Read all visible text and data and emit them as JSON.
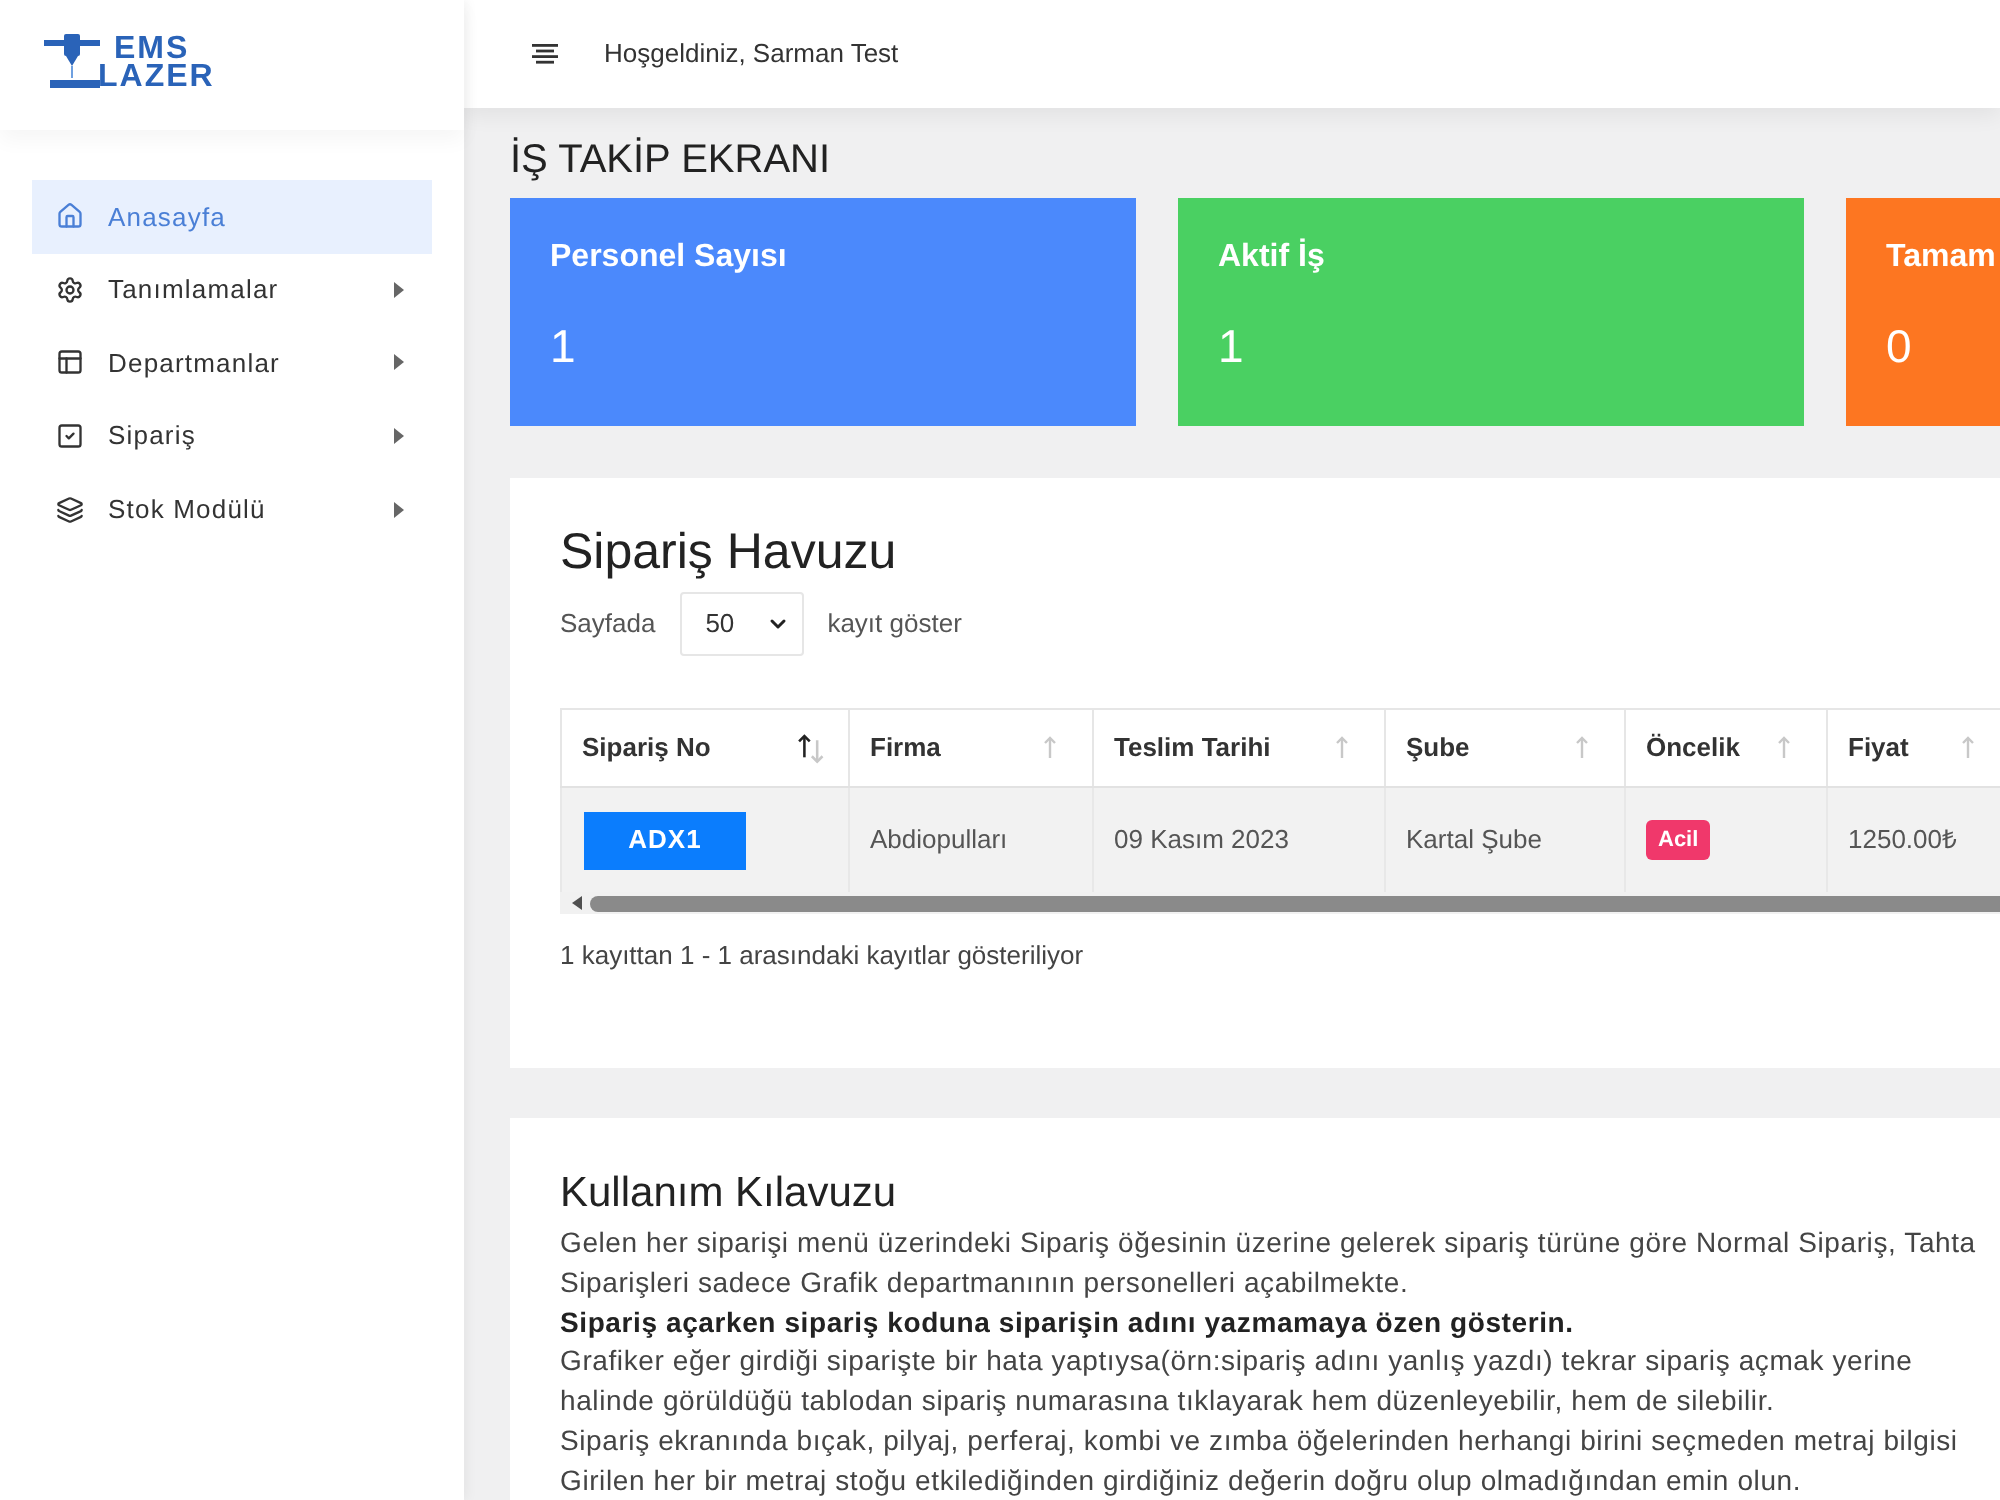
{
  "sidebar": {
    "logo": {
      "top": "EMS",
      "bottom": "LAZER"
    },
    "items": [
      {
        "label": "Anasayfa",
        "selected": true,
        "submenu": false
      },
      {
        "label": "Tanımlamalar",
        "selected": false,
        "submenu": true
      },
      {
        "label": "Departmanlar",
        "selected": false,
        "submenu": true
      },
      {
        "label": "Sipariş",
        "selected": false,
        "submenu": true
      },
      {
        "label": "Stok Modülü",
        "selected": false,
        "submenu": true
      }
    ]
  },
  "topbar": {
    "greeting": "Hoşgeldiniz, Sarman Test"
  },
  "page_title": "İŞ TAKİP EKRANI",
  "stat_cards": [
    {
      "label": "Personel Sayısı",
      "value": "1",
      "color": "#4b89fc"
    },
    {
      "label": "Aktif İş",
      "value": "1",
      "color": "#4ad062"
    },
    {
      "label": "Tamam",
      "value": "0",
      "color": "#fd7621"
    }
  ],
  "order_pool": {
    "title": "Sipariş Havuzu",
    "length_menu": {
      "before": "Sayfada",
      "value": "50",
      "after": "kayıt göster"
    },
    "table": {
      "columns": [
        {
          "label": "Sipariş No",
          "sorted": true
        },
        {
          "label": "Firma",
          "sorted": false
        },
        {
          "label": "Teslim Tarihi",
          "sorted": false
        },
        {
          "label": "Şube",
          "sorted": false
        },
        {
          "label": "Öncelik",
          "sorted": false
        },
        {
          "label": "Fiyat",
          "sorted": false
        }
      ],
      "rows": [
        {
          "cells": [
            {
              "kind": "button",
              "text": "ADX1"
            },
            {
              "kind": "text",
              "text": "Abdiopulları"
            },
            {
              "kind": "text",
              "text": "09 Kasım 2023"
            },
            {
              "kind": "text",
              "text": "Kartal Şube"
            },
            {
              "kind": "badge",
              "text": "Acil"
            },
            {
              "kind": "text",
              "text": "1250.00₺"
            }
          ]
        }
      ]
    },
    "info": "1 kayıttan 1 - 1 arasındaki kayıtlar gösteriliyor"
  },
  "guide": {
    "title": "Kullanım Kılavuzu",
    "lines": [
      {
        "text": "Gelen her siparişi menü üzerindeki Sipariş öğesinin üzerine gelerek sipariş türüne göre Normal Sipariş, Tahta",
        "bold": false
      },
      {
        "text": "Siparişleri sadece Grafik departmanının personelleri açabilmekte.",
        "bold": false
      },
      {
        "text": "Sipariş açarken sipariş koduna siparişin adını yazmamaya özen gösterin.",
        "bold": true
      },
      {
        "text": "Grafiker eğer girdiği siparişte bir hata yaptıysa(örn:sipariş adını yanlış yazdı) tekrar sipariş açmak yerine",
        "bold": false
      },
      {
        "text": "halinde görüldüğü tablodan sipariş numarasına tıklayarak hem düzenleyebilir, hem de silebilir.",
        "bold": false
      },
      {
        "text": "Sipariş ekranında bıçak, pilyaj, perferaj, kombi ve zımba öğelerinden herhangi birini seçmeden metraj bilgisi",
        "bold": false
      },
      {
        "text": "Girilen her bir metraj stoğu etkilediğinden girdiğiniz değerin doğru olup olmadığından emin olun.",
        "bold": false
      }
    ]
  }
}
